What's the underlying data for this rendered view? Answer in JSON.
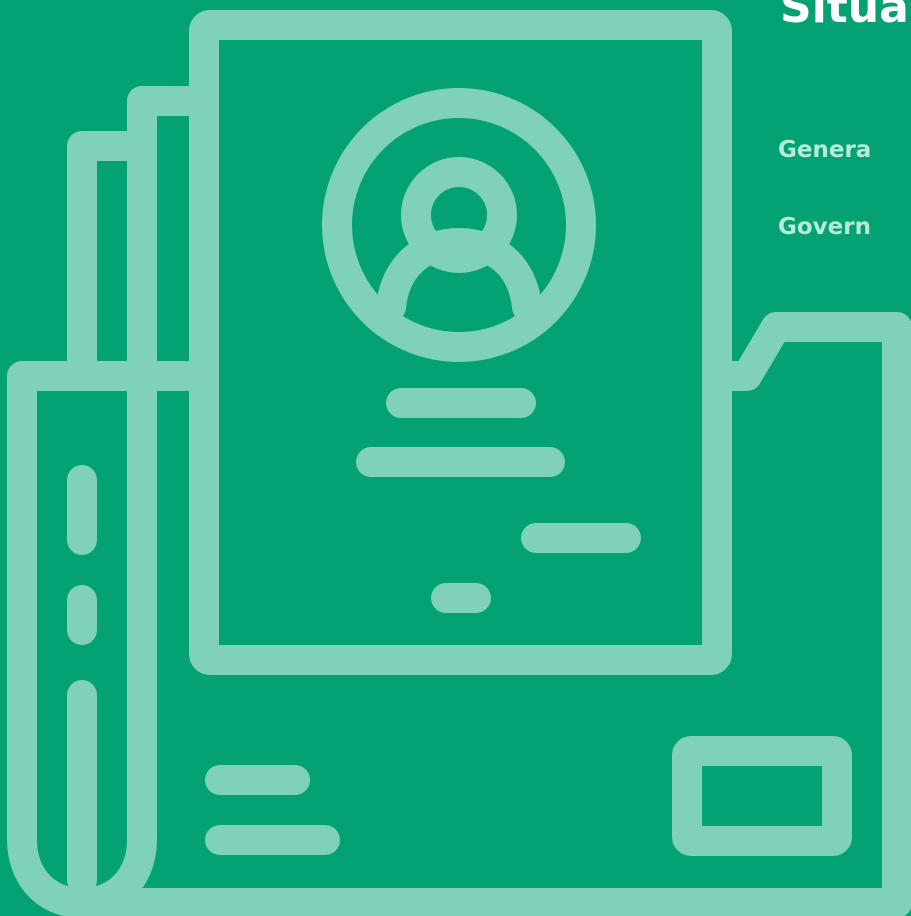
{
  "header": {
    "title": "Situa",
    "line1": "Genera",
    "line2": "Govern"
  },
  "illustration": {
    "icon": "newspaper-profile-icon"
  },
  "colors": {
    "background": "#03a174",
    "line_art": "#80d1bb",
    "title": "#ffffff",
    "subtitle": "#b8ead8"
  }
}
